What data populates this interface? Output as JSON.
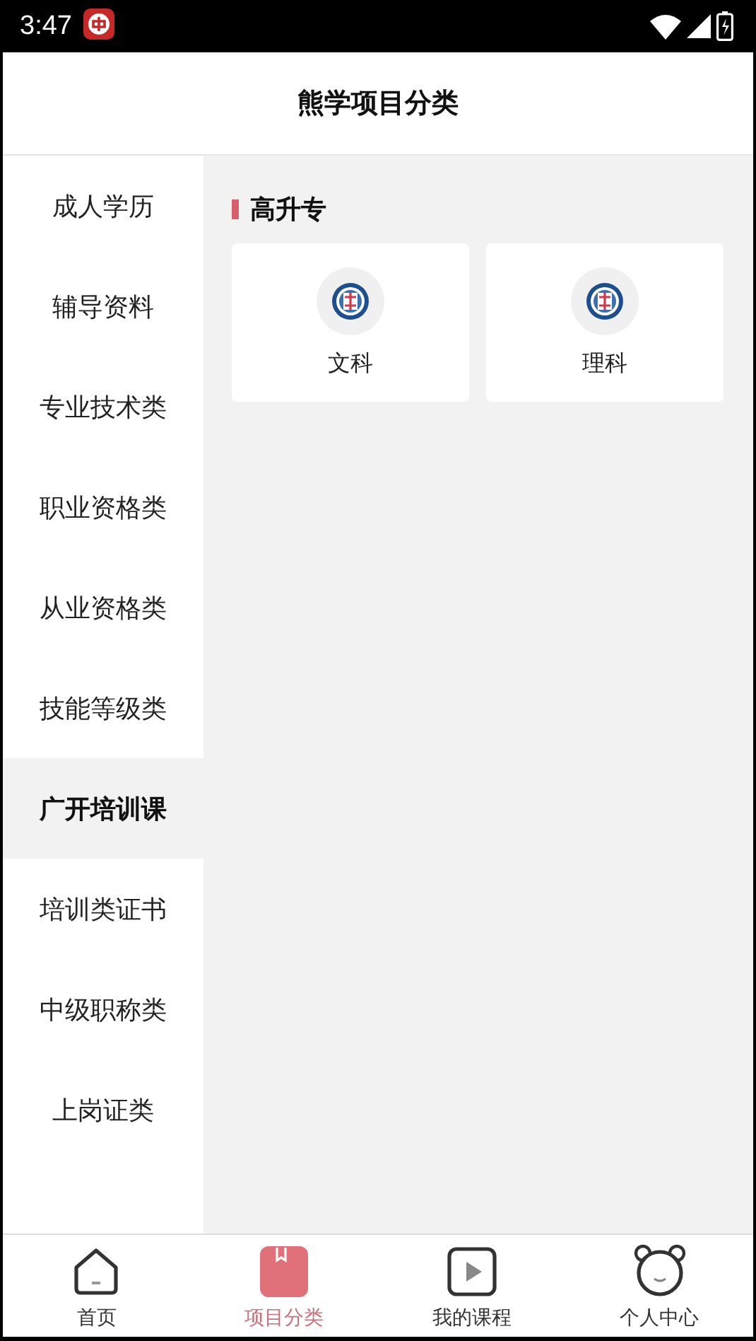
{
  "status_bar": {
    "time": "3:47"
  },
  "header": {
    "title": "熊学项目分类"
  },
  "sidebar": {
    "items": [
      {
        "label": "成人学历",
        "selected": false
      },
      {
        "label": "辅导资料",
        "selected": false
      },
      {
        "label": "专业技术类",
        "selected": false
      },
      {
        "label": "职业资格类",
        "selected": false
      },
      {
        "label": "从业资格类",
        "selected": false
      },
      {
        "label": "技能等级类",
        "selected": false
      },
      {
        "label": "广开培训课",
        "selected": true
      },
      {
        "label": "培训类证书",
        "selected": false
      },
      {
        "label": "中级职称类",
        "selected": false
      },
      {
        "label": "上岗证类",
        "selected": false
      }
    ]
  },
  "section": {
    "title": "高升专",
    "cards": [
      {
        "label": "文科"
      },
      {
        "label": "理科"
      }
    ]
  },
  "bottom_nav": [
    {
      "label": "首页",
      "kind": "home",
      "selected": false
    },
    {
      "label": "项目分类",
      "kind": "book",
      "selected": true
    },
    {
      "label": "我的课程",
      "kind": "play",
      "selected": false
    },
    {
      "label": "个人中心",
      "kind": "bear",
      "selected": false
    }
  ]
}
